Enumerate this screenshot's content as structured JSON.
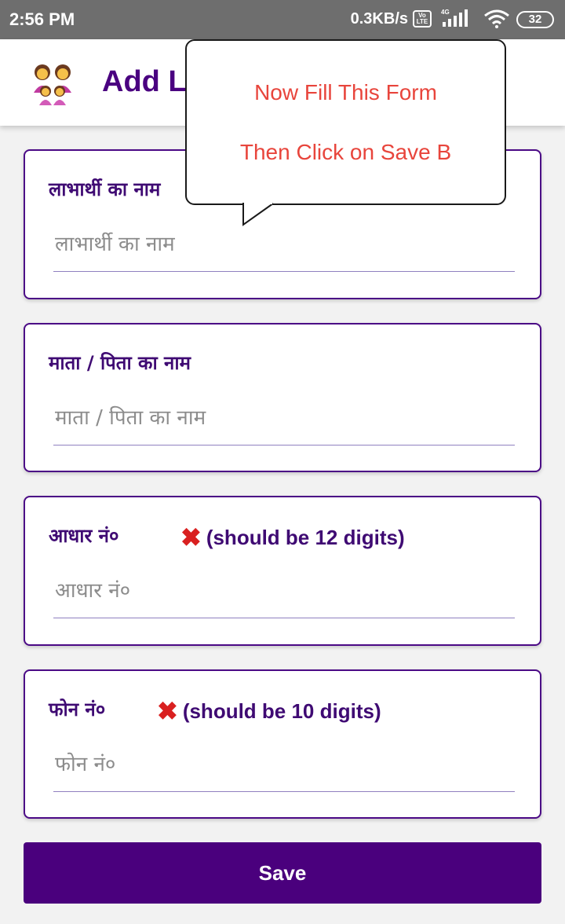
{
  "status_bar": {
    "time": "2:56 PM",
    "speed": "0.3KB/s",
    "volte": "Vo LTE",
    "network": "4G",
    "battery": "32"
  },
  "app_bar": {
    "icon": "family-emoji-icon",
    "title": "Add L"
  },
  "tooltip": {
    "line1": "Now Fill This Form",
    "line2": "Then Click on Save B"
  },
  "form": {
    "beneficiary": {
      "label": "लाभार्थी का नाम",
      "placeholder": "लाभार्थी का नाम"
    },
    "parent": {
      "label": "माता / पिता का नाम",
      "placeholder": "माता / पिता का नाम"
    },
    "aadhaar": {
      "label": "आधार नं०",
      "error_icon": "cross-mark-icon",
      "error": "(should be 12 digits)",
      "placeholder": "आधार नं०"
    },
    "phone": {
      "label": "फोन नं०",
      "error_icon": "cross-mark-icon",
      "error": "(should be 10 digits)",
      "placeholder": "फोन नं०"
    }
  },
  "save_label": "Save",
  "colors": {
    "accent": "#4a007d",
    "tooltip_text": "#e8453c",
    "error_icon": "#d92020",
    "status_bar": "#6e6e6e"
  }
}
